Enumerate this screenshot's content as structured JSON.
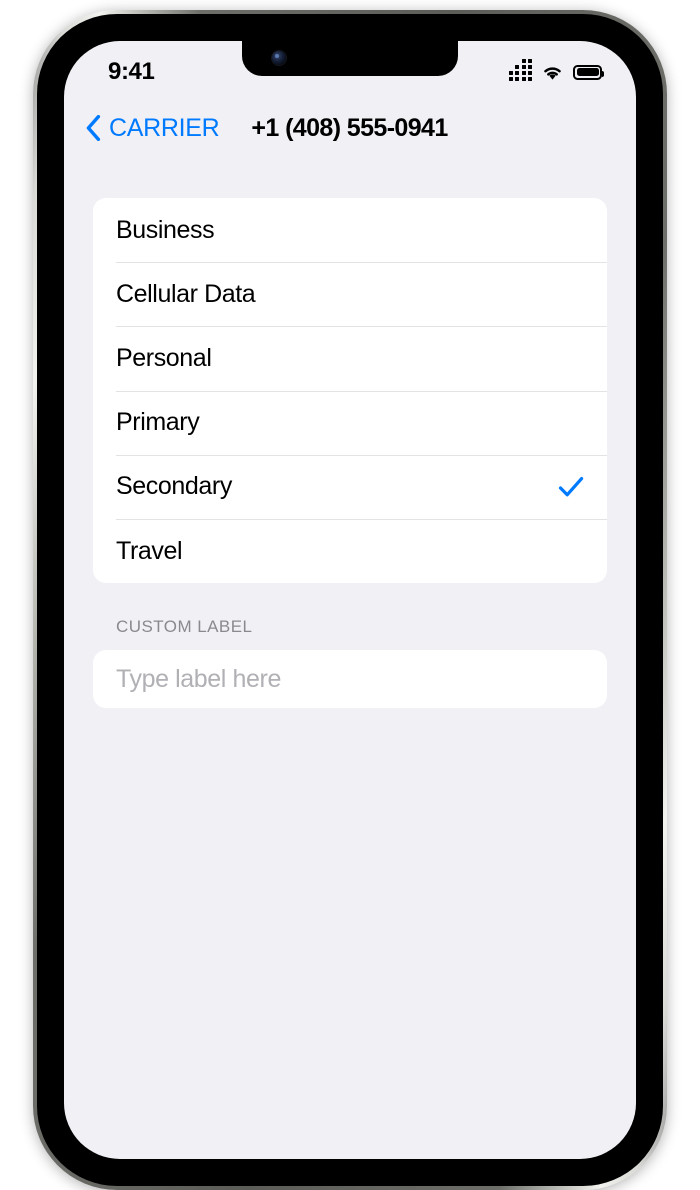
{
  "status_bar": {
    "time": "9:41",
    "cellular_icon": "cellular-signal-icon",
    "wifi_icon": "wifi-icon",
    "battery_icon": "battery-full-icon"
  },
  "nav_bar": {
    "back_icon": "chevron-left-icon",
    "back_label": "CARRIER",
    "title": "+1 (408) 555-0941"
  },
  "label_list": {
    "rows": [
      {
        "label": "Business",
        "selected": false
      },
      {
        "label": "Cellular Data",
        "selected": false
      },
      {
        "label": "Personal",
        "selected": false
      },
      {
        "label": "Primary",
        "selected": false
      },
      {
        "label": "Secondary",
        "selected": true
      },
      {
        "label": "Travel",
        "selected": false
      }
    ],
    "check_icon": "checkmark-icon"
  },
  "custom_label": {
    "header": "CUSTOM LABEL",
    "placeholder": "Type label here",
    "value": ""
  },
  "colors": {
    "accent_blue": "#007AFF",
    "screen_background": "#F0F0F5",
    "card_background": "#FFFFFF",
    "separator": "#E3E3E6",
    "secondary_text": "#8A8A8E",
    "placeholder_text": "#B0B0B5"
  }
}
